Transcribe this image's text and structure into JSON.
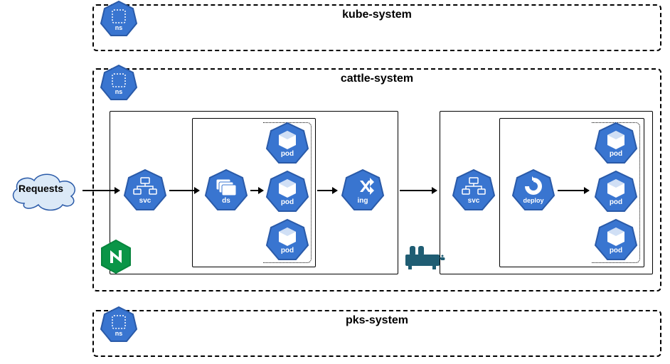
{
  "namespaces": {
    "kube": {
      "title": "kube-system",
      "badge": "ns"
    },
    "cattle": {
      "title": "cattle-system",
      "badge": "ns"
    },
    "pks": {
      "title": "pks-system",
      "badge": "ns"
    }
  },
  "requests_label": "Requests",
  "nodes": {
    "svc1": "svc",
    "ds": "ds",
    "pod1": "pod",
    "pod2": "pod",
    "pod3": "pod",
    "ing": "ing",
    "svc2": "svc",
    "deploy": "deploy",
    "pod4": "pod",
    "pod5": "pod",
    "pod6": "pod"
  },
  "chart_data": {
    "type": "table",
    "description": "Kubernetes architecture diagram showing request flow through cattle-system namespace",
    "namespaces": [
      "kube-system",
      "cattle-system",
      "pks-system"
    ],
    "flow": [
      "Requests",
      "svc (nginx)",
      "ds",
      "pod x3",
      "ing",
      "svc (rancher)",
      "deploy",
      "pod x3"
    ],
    "edges": [
      [
        "Requests",
        "svc1"
      ],
      [
        "svc1",
        "ds"
      ],
      [
        "ds",
        "pods-left"
      ],
      [
        "pods-left",
        "ing"
      ],
      [
        "ing",
        "svc2"
      ],
      [
        "svc2",
        "deploy"
      ],
      [
        "deploy",
        "pods-right"
      ]
    ],
    "logos": {
      "nginx": "left-group",
      "rancher": "right-group"
    }
  }
}
